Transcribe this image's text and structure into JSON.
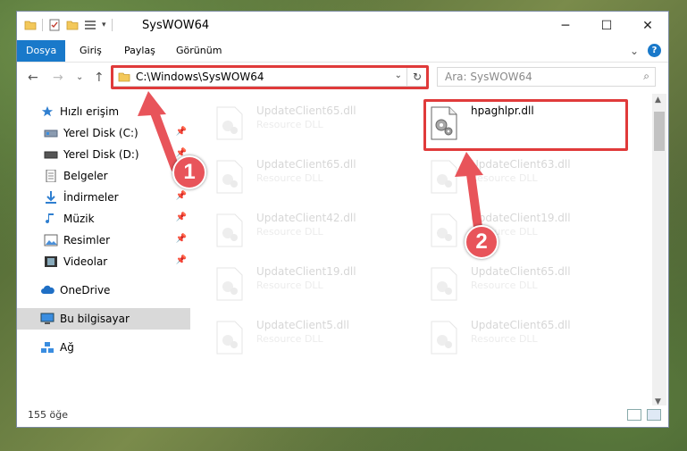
{
  "window": {
    "title": "SysWOW64",
    "controls": {
      "minimize": "─",
      "maximize": "☐",
      "close": "✕"
    }
  },
  "ribbon": {
    "tabs": [
      "Dosya",
      "Giriş",
      "Paylaş",
      "Görünüm"
    ],
    "active_tab": "Dosya",
    "collapse_chevron": "⌄",
    "help": "?"
  },
  "navbar": {
    "back": "←",
    "forward": "→",
    "recent": "⌄",
    "up": "↑",
    "address": "C:\\Windows\\SysWOW64",
    "address_dropdown": "⌄",
    "refresh": "↻",
    "search_placeholder": "Ara: SysWOW64",
    "search_icon": "⌕"
  },
  "sidebar": {
    "items": [
      {
        "label": "Hızlı erişim",
        "icon": "star-icon",
        "pinned": false
      },
      {
        "label": "Yerel Disk (C:)",
        "icon": "drive-icon",
        "pinned": true
      },
      {
        "label": "Yerel Disk (D:)",
        "icon": "drive-icon",
        "pinned": true
      },
      {
        "label": "Belgeler",
        "icon": "documents-icon",
        "pinned": true
      },
      {
        "label": "İndirmeler",
        "icon": "downloads-icon",
        "pinned": true
      },
      {
        "label": "Müzik",
        "icon": "music-icon",
        "pinned": true
      },
      {
        "label": "Resimler",
        "icon": "pictures-icon",
        "pinned": true
      },
      {
        "label": "Videolar",
        "icon": "videos-icon",
        "pinned": true
      },
      {
        "label": "OneDrive",
        "icon": "cloud-icon",
        "pinned": false
      },
      {
        "label": "Bu bilgisayar",
        "icon": "computer-icon",
        "pinned": false,
        "selected": true
      },
      {
        "label": "Ağ",
        "icon": "network-icon",
        "pinned": false
      }
    ],
    "pin_glyph": "📌"
  },
  "files": {
    "left_column": [
      {
        "name": "UpdateClient65.dll",
        "desc": "Resource DLL"
      },
      {
        "name": "UpdateClient65.dll",
        "desc": "Resource DLL"
      },
      {
        "name": "UpdateClient42.dll",
        "desc": "Resource DLL"
      },
      {
        "name": "UpdateClient19.dll",
        "desc": "Resource DLL"
      },
      {
        "name": "UpdateClient5.dll",
        "desc": "Resource DLL"
      }
    ],
    "right_column": [
      {
        "name": "hpaghlpr.dll",
        "desc": "",
        "highlighted": true
      },
      {
        "name": "UpdateClient63.dll",
        "desc": "Resource DLL"
      },
      {
        "name": "UpdateClient19.dll",
        "desc": "Resource DLL"
      },
      {
        "name": "UpdateClient65.dll",
        "desc": "Resource DLL"
      },
      {
        "name": "UpdateClient65.dll",
        "desc": "Resource DLL"
      }
    ]
  },
  "status": {
    "item_count": "155 öğe"
  },
  "annotations": {
    "callout_1": "1",
    "callout_2": "2",
    "color": "#e03a3a"
  },
  "colors": {
    "accent": "#1979ca",
    "highlight": "#e03a3a"
  }
}
